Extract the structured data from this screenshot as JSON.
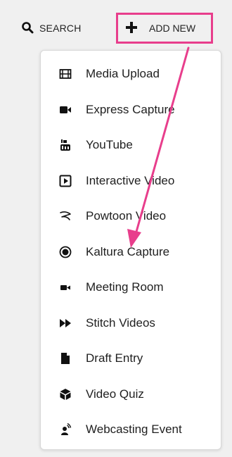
{
  "header": {
    "search_label": "SEARCH",
    "add_new_label": "ADD NEW"
  },
  "menu": {
    "items": [
      {
        "label": "Media Upload",
        "icon": "film-icon"
      },
      {
        "label": "Express Capture",
        "icon": "video-camera-icon"
      },
      {
        "label": "YouTube",
        "icon": "youtube-icon"
      },
      {
        "label": "Interactive Video",
        "icon": "play-square-icon"
      },
      {
        "label": "Powtoon Video",
        "icon": "powtoon-icon"
      },
      {
        "label": "Kaltura Capture",
        "icon": "record-circle-icon"
      },
      {
        "label": "Meeting Room",
        "icon": "meeting-camera-icon"
      },
      {
        "label": "Stitch Videos",
        "icon": "fast-forward-icon"
      },
      {
        "label": "Draft Entry",
        "icon": "file-icon"
      },
      {
        "label": "Video Quiz",
        "icon": "cube-icon"
      },
      {
        "label": "Webcasting Event",
        "icon": "broadcast-user-icon"
      }
    ]
  },
  "colors": {
    "highlight": "#e83e8c",
    "background": "#f0f0f0",
    "menu_bg": "#ffffff"
  }
}
